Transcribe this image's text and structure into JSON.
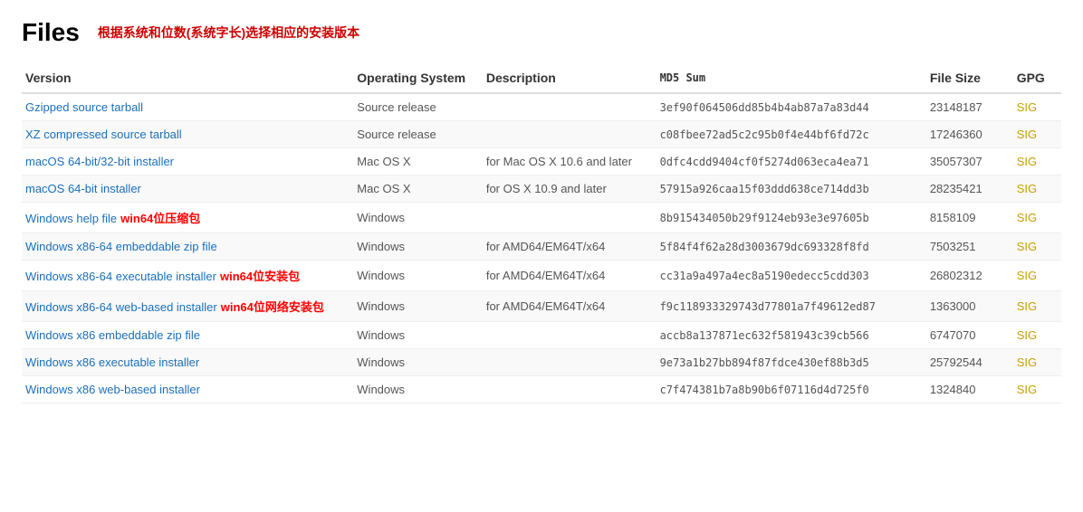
{
  "page": {
    "title": "Files",
    "subtitle": "根据系统和位数(系统字长)选择相应的安装版本"
  },
  "table": {
    "headers": [
      "Version",
      "Operating System",
      "Description",
      "MD5 Sum",
      "File Size",
      "GPG"
    ],
    "rows": [
      {
        "version": "Gzipped source tarball",
        "os": "Source release",
        "desc": "",
        "md5": "3ef90f064506dd85b4b4ab87a7a83d44",
        "size": "23148187",
        "gpg": "SIG",
        "annotation": ""
      },
      {
        "version": "XZ compressed source tarball",
        "os": "Source release",
        "desc": "",
        "md5": "c08fbee72ad5c2c95b0f4e44bf6fd72c",
        "size": "17246360",
        "gpg": "SIG",
        "annotation": ""
      },
      {
        "version": "macOS 64-bit/32-bit installer",
        "os": "Mac OS X",
        "desc": "for Mac OS X 10.6 and later",
        "md5": "0dfc4cdd9404cf0f5274d063eca4ea71",
        "size": "35057307",
        "gpg": "SIG",
        "annotation": ""
      },
      {
        "version": "macOS 64-bit installer",
        "os": "Mac OS X",
        "desc": "for OS X 10.9 and later",
        "md5": "57915a926caa15f03ddd638ce714dd3b",
        "size": "28235421",
        "gpg": "SIG",
        "annotation": ""
      },
      {
        "version": "Windows help file",
        "os": "Windows",
        "desc": "",
        "md5": "8b915434050b29f9124eb93e3e97605b",
        "size": "8158109",
        "gpg": "SIG",
        "annotation": "win64位压缩包"
      },
      {
        "version": "Windows x86-64 embeddable zip file",
        "os": "Windows",
        "desc": "for AMD64/EM64T/x64",
        "md5": "5f84f4f62a28d3003679dc693328f8fd",
        "size": "7503251",
        "gpg": "SIG",
        "annotation": ""
      },
      {
        "version": "Windows x86-64 executable installer",
        "os": "Windows",
        "desc": "for AMD64/EM64T/x64",
        "md5": "cc31a9a497a4ec8a5190edecc5cdd303",
        "size": "26802312",
        "gpg": "SIG",
        "annotation": "win64位安装包"
      },
      {
        "version": "Windows x86-64 web-based installer",
        "os": "Windows",
        "desc": "for AMD64/EM64T/x64",
        "md5": "f9c118933329743d77801a7f49612ed87",
        "size": "1363000",
        "gpg": "SIG",
        "annotation": "win64位网络安装包"
      },
      {
        "version": "Windows x86 embeddable zip file",
        "os": "Windows",
        "desc": "",
        "md5": "accb8a137871ec632f581943c39cb566",
        "size": "6747070",
        "gpg": "SIG",
        "annotation": ""
      },
      {
        "version": "Windows x86 executable installer",
        "os": "Windows",
        "desc": "",
        "md5": "9e73a1b27bb894f87fdce430ef88b3d5",
        "size": "25792544",
        "gpg": "SIG",
        "annotation": ""
      },
      {
        "version": "Windows x86 web-based installer",
        "os": "Windows",
        "desc": "",
        "md5": "c7f474381b7a8b90b6f07116d4d725f0",
        "size": "1324840",
        "gpg": "SIG",
        "annotation": ""
      }
    ]
  }
}
